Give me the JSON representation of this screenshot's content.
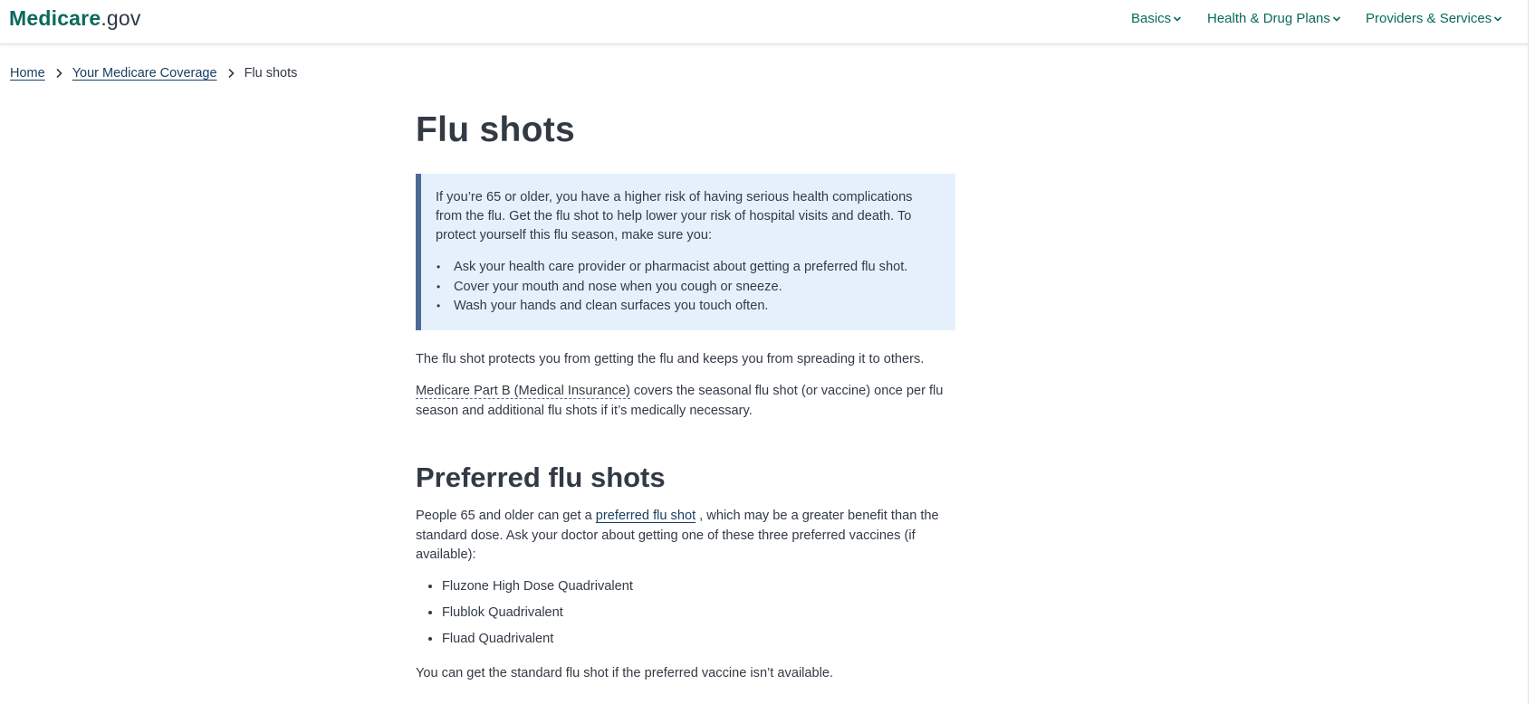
{
  "header": {
    "logo_brand": "Medicare",
    "logo_tld": ".gov",
    "nav": [
      {
        "label": "Basics"
      },
      {
        "label": "Health & Drug Plans"
      },
      {
        "label": "Providers & Services"
      }
    ]
  },
  "breadcrumb": {
    "home": "Home",
    "coverage": "Your Medicare Coverage",
    "current": "Flu shots"
  },
  "main": {
    "title": "Flu shots",
    "callout": {
      "text": "If you’re 65 or older, you have a higher risk of having serious health complications from the flu. Get the flu shot to help lower your risk of hospital visits and death. To protect yourself this flu season, make sure you:",
      "items": [
        "Ask your health care provider or pharmacist about getting a preferred flu shot.",
        "Cover your mouth and nose when you cough or sneeze.",
        "Wash your hands and clean surfaces you touch often."
      ]
    },
    "para1": "The flu shot protects you from getting the flu  and keeps you from spreading it to others.",
    "para2_term": "Medicare Part B (Medical Insurance)",
    "para2_rest": " covers the seasonal flu shot (or vaccine) once per flu season and additional flu shots if it’s medically necessary.",
    "preferred": {
      "heading": "Preferred flu shots",
      "intro_before": "People 65 and older can get a ",
      "intro_link": "preferred flu shot",
      "intro_after": " , which may be a greater benefit than the standard dose. Ask your doctor about getting one of these three preferred vaccines (if available):",
      "vaccines": [
        "Fluzone High Dose Quadrivalent",
        "Flublok Quadrivalent",
        "Fluad Quadrivalent"
      ],
      "closing": "You can get the standard flu shot if the preferred vaccine isn’t available."
    }
  },
  "icons": {
    "nav_chevron": "chevron-down-icon",
    "breadcrumb_separator": "chevron-right-icon"
  },
  "colors": {
    "brand": "#0a6a5b",
    "link": "#1a3e63",
    "callout_bg": "#e6f0fd",
    "callout_border": "#4f6a95",
    "text": "#323a45"
  }
}
